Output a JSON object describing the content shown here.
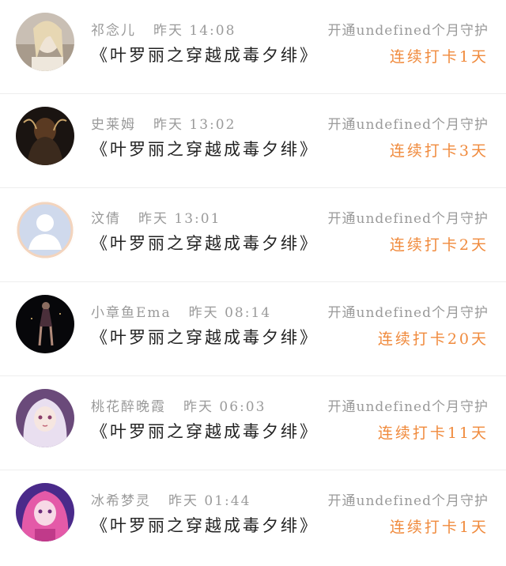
{
  "colors": {
    "accent": "#f08a3c",
    "muted": "#9a9a9a",
    "title": "#222222"
  },
  "entries": [
    {
      "name": "祁念儿",
      "time": "昨天 14:08",
      "title": "《叶罗丽之穿越成毒夕绯》",
      "guard": "开通undefined个月守护",
      "checkin": "连续打卡1天",
      "avatar": "avatar-girl-photo"
    },
    {
      "name": "史莱姆",
      "time": "昨天 13:02",
      "title": "《叶罗丽之穿越成毒夕绯》",
      "guard": "开通undefined个月守护",
      "checkin": "连续打卡3天",
      "avatar": "avatar-dark-figure"
    },
    {
      "name": "汶倩",
      "time": "昨天 13:01",
      "title": "《叶罗丽之穿越成毒夕绯》",
      "guard": "开通undefined个月守护",
      "checkin": "连续打卡2天",
      "avatar": "avatar-default-placeholder"
    },
    {
      "name": "小章鱼Ema",
      "time": "昨天 08:14",
      "title": "《叶罗丽之穿越成毒夕绯》",
      "guard": "开通undefined个月守护",
      "checkin": "连续打卡20天",
      "avatar": "avatar-dancer"
    },
    {
      "name": "桃花醉晚霞",
      "time": "昨天 06:03",
      "title": "《叶罗丽之穿越成毒夕绯》",
      "guard": "开通undefined个月守护",
      "checkin": "连续打卡11天",
      "avatar": "avatar-anime-girl"
    },
    {
      "name": "冰希梦灵",
      "time": "昨天 01:44",
      "title": "《叶罗丽之穿越成毒夕绯》",
      "guard": "开通undefined个月守护",
      "checkin": "连续打卡1天",
      "avatar": "avatar-pink-hair-girl"
    }
  ]
}
